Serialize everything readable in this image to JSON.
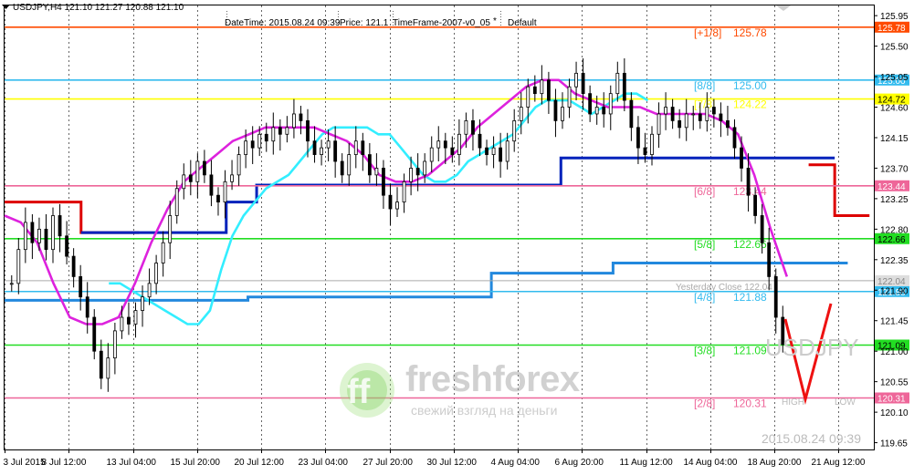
{
  "window": {
    "symbol_info": "USDJPY,H4  121.10 121.27 120.88 121.10",
    "menu_arrow_icon": "triangle-down-icon"
  },
  "info_bar": {
    "datetime": "DateTime: 2015.08.24 09:39",
    "price": "Price: 121.1",
    "timeframe": "TimeFrame-2007-v0_05",
    "asterisk": "*",
    "preset": "Default"
  },
  "price_axis": {
    "ticks": [
      "125.95",
      "125.50",
      "125.05",
      "124.60",
      "124.15",
      "123.70",
      "123.25",
      "122.80",
      "122.35",
      "121.90",
      "121.45",
      "121.00",
      "120.55",
      "120.10",
      "119.65"
    ],
    "ymin": 119.55,
    "ymax": 126.1
  },
  "time_axis": {
    "labels": [
      "3 Jul 2015",
      "8 Jul 12:00",
      "13 Jul 04:00",
      "15 Jul 20:00",
      "20 Jul 12:00",
      "23 Jul 04:00",
      "27 Jul 20:00",
      "30 Jul 12:00",
      "4 Aug 04:00",
      "6 Aug 20:00",
      "11 Aug 12:00",
      "14 Aug 04:00",
      "18 Aug 20:00",
      "21 Aug 12:00"
    ]
  },
  "levels": [
    {
      "label": "[+1/8]",
      "value_text": "125.78",
      "badge": "125.78",
      "value": 125.78,
      "color": "#ff4a00"
    },
    {
      "label": "[8/8]",
      "value_text": "125.00",
      "badge": "125.00",
      "value": 125.0,
      "color": "#33bbee"
    },
    {
      "label": "[7/8]",
      "value_text": "124.22",
      "badge": "124.72",
      "value": 124.72,
      "color": "#ffff00"
    },
    {
      "label": "[6/8]",
      "value_text": "123.44",
      "badge": "123.44",
      "value": 123.44,
      "color": "#ee6699"
    },
    {
      "label": "[5/8]",
      "value_text": "122.66",
      "badge": "122.66",
      "value": 122.66,
      "color": "#22dd22"
    },
    {
      "label": "[4/8]",
      "value_text": "121.88",
      "badge": "121.88",
      "value": 121.88,
      "color": "#33bbee"
    },
    {
      "label": "[3/8]",
      "value_text": "121.09",
      "badge": "121.09",
      "value": 121.09,
      "color": "#22dd22"
    },
    {
      "label": "[2/8]",
      "value_text": "120.31",
      "badge": "120.31",
      "value": 120.31,
      "color": "#ee6699"
    }
  ],
  "yesterday_close": {
    "label": "Yesterday Close 122.04",
    "badge": "122.04",
    "value": 122.04,
    "color": "#aaaaaa"
  },
  "watermarks": {
    "symbol": "USDJPY",
    "brand": "freshforex",
    "brand_sub": "свежий взгляд на деньги",
    "timestamp": "2015.08.24 09:39",
    "high": "HIGH",
    "low": "LOW"
  },
  "colors": {
    "red_step": "#dd0000",
    "blue_step": "#0022bb",
    "lightblue_step": "#2288dd",
    "cyan_line": "#33eeff",
    "magenta_line": "#dd22dd",
    "candles": "#000000",
    "v_marker": "#ee1111"
  },
  "chart_data": {
    "type": "candlestick",
    "symbol": "USDJPY",
    "timeframe": "H4",
    "ylim": [
      119.55,
      126.1
    ],
    "last_bar": {
      "open": 121.1,
      "high": 121.27,
      "low": 120.88,
      "close": 121.1
    },
    "closes": [
      122.0,
      122.5,
      122.9,
      122.6,
      122.8,
      122.5,
      123.0,
      122.7,
      122.4,
      122.1,
      121.8,
      121.5,
      121.0,
      120.6,
      120.9,
      121.3,
      121.5,
      121.4,
      121.6,
      121.8,
      122.0,
      122.3,
      122.6,
      123.0,
      123.4,
      123.6,
      123.5,
      123.8,
      123.6,
      123.3,
      123.2,
      123.5,
      123.6,
      123.9,
      124.1,
      124.0,
      124.2,
      124.1,
      124.3,
      124.2,
      124.3,
      124.5,
      124.4,
      124.1,
      123.9,
      124.0,
      124.1,
      123.8,
      123.6,
      123.9,
      124.1,
      123.9,
      123.6,
      123.7,
      123.3,
      123.1,
      123.2,
      123.5,
      123.7,
      123.6,
      123.8,
      124.0,
      124.1,
      124.0,
      123.9,
      124.2,
      124.4,
      124.2,
      124.0,
      123.9,
      124.0,
      123.8,
      124.1,
      124.4,
      124.6,
      124.9,
      124.8,
      125.0,
      124.7,
      124.4,
      124.6,
      124.9,
      125.1,
      124.8,
      124.5,
      124.6,
      124.5,
      124.8,
      125.1,
      124.7,
      124.3,
      124.0,
      123.9,
      124.2,
      124.5,
      124.6,
      124.4,
      124.3,
      124.5,
      124.5,
      124.4,
      124.6,
      124.5,
      124.4,
      124.3,
      124.0,
      123.7,
      123.3,
      123.0,
      122.6,
      122.1,
      121.5,
      121.1
    ],
    "bands": {
      "red": [
        {
          "x0": 0.0,
          "x1": 0.088,
          "v": 123.2
        },
        {
          "x0": 0.088,
          "x1": 0.155,
          "v": 122.75
        },
        {
          "x0": 0.925,
          "x1": 0.955,
          "v": 123.75
        },
        {
          "x0": 0.955,
          "x1": 0.995,
          "v": 123.0
        }
      ],
      "blue": [
        {
          "x0": 0.088,
          "x1": 0.255,
          "v": 122.75
        },
        {
          "x0": 0.255,
          "x1": 0.29,
          "v": 123.2
        },
        {
          "x0": 0.29,
          "x1": 0.64,
          "v": 123.45
        },
        {
          "x0": 0.64,
          "x1": 0.955,
          "v": 123.85
        }
      ],
      "lightblue": [
        {
          "x0": 0.0,
          "x1": 0.28,
          "v": 121.75
        },
        {
          "x0": 0.28,
          "x1": 0.56,
          "v": 121.8
        },
        {
          "x0": 0.56,
          "x1": 0.7,
          "v": 122.15
        },
        {
          "x0": 0.7,
          "x1": 0.97,
          "v": 122.3
        }
      ]
    },
    "cyan_line_y": [
      122.0,
      122.0,
      121.9,
      121.8,
      121.7,
      121.6,
      121.5,
      121.4,
      121.4,
      121.6,
      122.2,
      122.7,
      123.0,
      123.2,
      123.4,
      123.5,
      123.6,
      123.8,
      124.0,
      124.2,
      124.3,
      124.3,
      124.3,
      124.3,
      124.2,
      124.2,
      124.0,
      123.8,
      123.6,
      123.5,
      123.5,
      123.6,
      123.8,
      123.9,
      124.0,
      124.1,
      124.2,
      124.4,
      124.6,
      124.7,
      124.7,
      124.7,
      124.6,
      124.5,
      124.6,
      124.7,
      124.8,
      124.8,
      124.7
    ],
    "magenta_line_y": [
      123.0,
      122.9,
      122.6,
      122.0,
      121.5,
      121.4,
      121.4,
      121.5,
      122.0,
      122.6,
      123.1,
      123.5,
      123.7,
      123.9,
      124.1,
      124.2,
      124.3,
      124.3,
      124.3,
      124.3,
      124.2,
      124.1,
      123.9,
      123.6,
      123.5,
      123.5,
      123.6,
      123.8,
      124.0,
      124.3,
      124.5,
      124.7,
      124.9,
      125.0,
      125.0,
      124.8,
      124.7,
      124.6,
      124.6,
      124.6,
      124.5,
      124.5,
      124.5,
      124.5,
      124.4,
      124.2,
      123.6,
      122.8,
      122.1
    ]
  }
}
